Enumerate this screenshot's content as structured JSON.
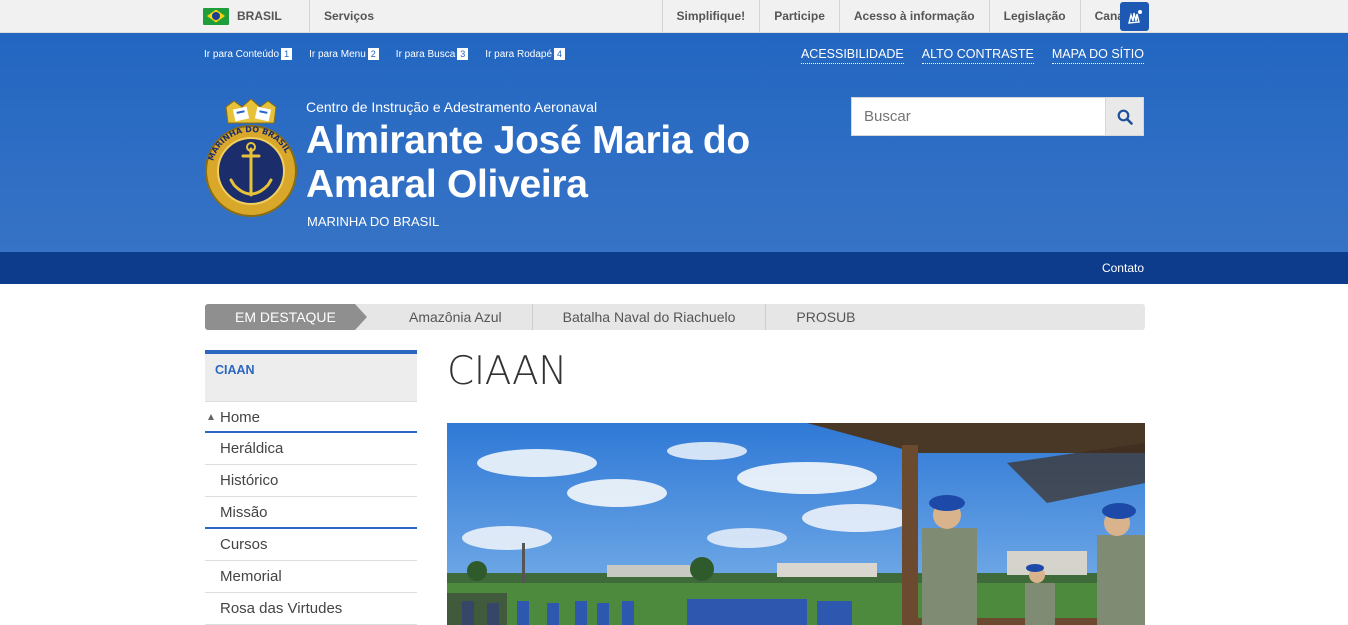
{
  "govbar": {
    "country": "BRASIL",
    "servicos": "Serviços",
    "links": [
      "Simplifique!",
      "Participe",
      "Acesso à informação",
      "Legislação",
      "Canais"
    ]
  },
  "header": {
    "skip_links": [
      {
        "label": "Ir para Conteúdo",
        "key": "1"
      },
      {
        "label": "Ir para Menu",
        "key": "2"
      },
      {
        "label": "Ir para Busca",
        "key": "3"
      },
      {
        "label": "Ir para Rodapé",
        "key": "4"
      }
    ],
    "accessibility": "ACESSIBILIDADE",
    "contrast": "ALTO CONTRASTE",
    "sitemap": "MAPA DO SÍTIO",
    "pre_title": "Centro de Instrução e Adestramento Aeronaval",
    "title": "Almirante José Maria do Amaral Oliveira",
    "subtitle": "MARINHA DO BRASIL",
    "emblem_text": "MARINHA DO BRASIL",
    "search_placeholder": "Buscar"
  },
  "darkbar": {
    "contato": "Contato"
  },
  "destaque": {
    "label": "EM DESTAQUE",
    "items": [
      "Amazônia Azul",
      "Batalha Naval do Riachuelo",
      "PROSUB"
    ]
  },
  "sidebar": {
    "heading": "CIAAN",
    "home": "Home",
    "group1": [
      "Heráldica",
      "Histórico",
      "Missão"
    ],
    "group2": [
      "Cursos",
      "Memorial",
      "Rosa das Virtudes"
    ]
  },
  "main": {
    "title": "CIAAN"
  },
  "colors": {
    "header_blue": "#2266c1",
    "dark_bar": "#0e3c8c",
    "accent": "#2b66c2"
  }
}
